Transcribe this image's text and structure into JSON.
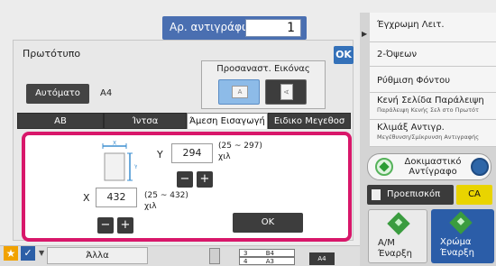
{
  "copies": {
    "label": "Αρ. αντιγράφων",
    "value": "1"
  },
  "panel": {
    "title": "Πρωτότυπο",
    "ok": "OK",
    "auto_button": "Αυτόματο",
    "auto_size": "A4",
    "adjust": {
      "title": "Προσαναστ. Εικόνας",
      "btn_a": "A",
      "btn_b": "A"
    },
    "tabs": [
      {
        "label": "AB"
      },
      {
        "label": "Ίντσα"
      },
      {
        "label": "Άμεση Εισαγωγή"
      },
      {
        "label": "Ειδικο Μεγεθοσ"
      }
    ],
    "active_tab": 2,
    "direct_entry": {
      "y": {
        "label": "Y",
        "value": "294",
        "range": "(25 ~ 297)",
        "unit": "χιλ"
      },
      "x": {
        "label": "X",
        "value": "432",
        "range": "(25 ~ 432)",
        "unit": "χιλ"
      },
      "minus": "−",
      "plus": "+",
      "ok": "OK",
      "axis_x": "X",
      "axis_y": "Y"
    }
  },
  "right_menu": [
    {
      "label": "Έγχρωμη Λειτ.",
      "sub": ""
    },
    {
      "label": "2-Όψεων",
      "sub": ""
    },
    {
      "label": "Ρύθμιση Φόντου",
      "sub": ""
    },
    {
      "label": "Κενή Σελίδα Παράλειψη",
      "sub": "Παράλειψη Κενής Σελ στο Πρωτότ"
    },
    {
      "label": "Κλιμάξ Αντιγρ.",
      "sub": "Μεγέθυνση/Σμίκρυνση Αντιγραφής"
    }
  ],
  "proof_copy": "Δοκιμαστικό Αντίγραφο",
  "preview": "Προεπισκόπ",
  "ca": "CA",
  "start_bw": {
    "mode": "Α/Μ",
    "action": "Έναρξη"
  },
  "start_color": {
    "mode": "Χρώμα",
    "action": "Έναρξη"
  },
  "bottom": {
    "other": "Άλλα",
    "tray_b4": "B4",
    "tray_a3": "A3",
    "tray_b4_num": "3",
    "tray_a3_num": "4",
    "a4_tag": "A4"
  },
  "colors": {
    "accent": "#3471b9",
    "highlight": "#d8176a",
    "ca": "#e9d400",
    "start_green": "#3a9c3f"
  }
}
